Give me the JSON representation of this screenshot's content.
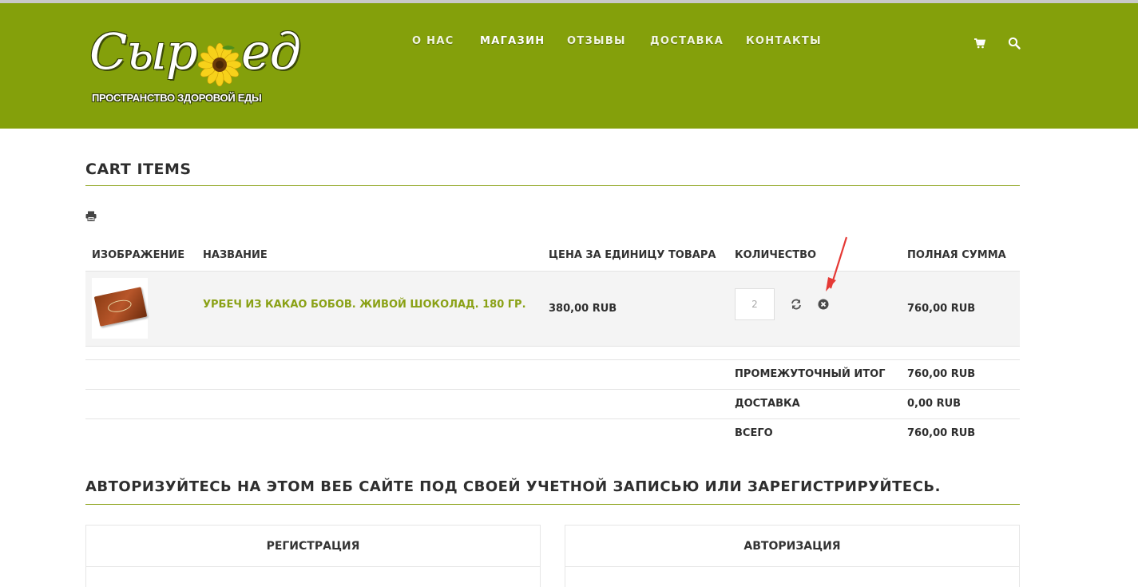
{
  "brand": {
    "logo_main_part1": "Сыр",
    "logo_main_part2": "ед",
    "logo_tagline": "ПРОСТРАНСТВО ЗДОРОВОЙ ЕДЫ",
    "color": "#84a00b"
  },
  "nav": {
    "items": [
      {
        "label": "О НАС"
      },
      {
        "label": "МАГАЗИН"
      },
      {
        "label": "ОТЗЫВЫ"
      },
      {
        "label": "ДОСТАВКА"
      },
      {
        "label": "КОНТАКТЫ"
      }
    ],
    "active": "МАГАЗИН",
    "icons": [
      "cart-icon",
      "search-icon"
    ]
  },
  "cart": {
    "title": "CART ITEMS",
    "print_icon": "print-icon",
    "columns": [
      "ИЗОБРАЖЕНИЕ",
      "НАЗВАНИЕ",
      "ЦЕНА ЗА ЕДИНИЦУ ТОВАРА",
      "КОЛИЧЕСТВО",
      "ПОЛНАЯ СУММА"
    ],
    "items": [
      {
        "name": "УРБЕЧ ИЗ КАКАО БОБОВ. ЖИВОЙ ШОКОЛАД. 180 ГР.",
        "unit_price": "380,00 RUB",
        "quantity": "2",
        "total": "760,00 RUB"
      }
    ],
    "totals": [
      {
        "label": "ПРОМЕЖУТОЧНЫЙ ИТОГ",
        "value": "760,00 RUB"
      },
      {
        "label": "ДОСТАВКА",
        "value": "0,00 RUB"
      },
      {
        "label": "ВСЕГО",
        "value": "760,00 RUB"
      }
    ]
  },
  "auth": {
    "title": "АВТОРИЗУЙТЕСЬ НА ЭТОМ ВЕБ САЙТЕ ПОД СВОЕЙ УЧЕТНОЙ ЗАПИСЬЮ ИЛИ ЗАРЕГИСТРИРУЙТЕСЬ.",
    "register_label": "РЕГИСТРАЦИЯ",
    "login_label": "АВТОРИЗАЦИЯ"
  },
  "colors": {
    "accent": "#84a00b",
    "link": "#8aa116",
    "arrow": "#e53935"
  }
}
